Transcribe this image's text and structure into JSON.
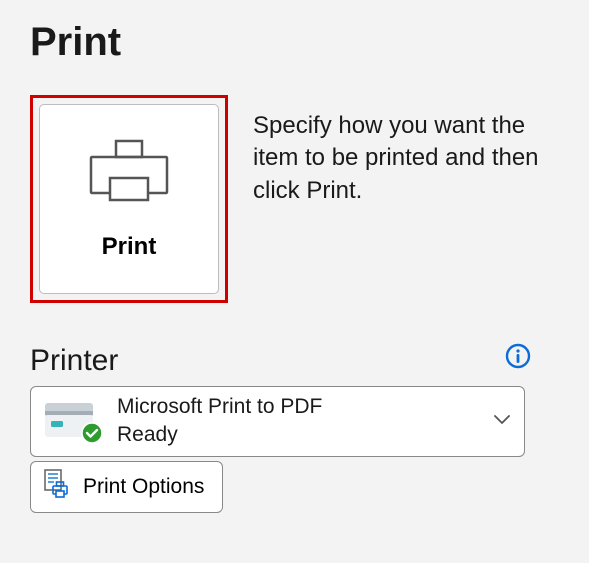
{
  "title": "Print",
  "printButton": {
    "label": "Print"
  },
  "instruction": "Specify how you want the item to be printed and then click Print.",
  "printerSection": {
    "heading": "Printer",
    "selected": {
      "name": "Microsoft Print to PDF",
      "status": "Ready"
    }
  },
  "printOptions": {
    "label": "Print Options"
  }
}
